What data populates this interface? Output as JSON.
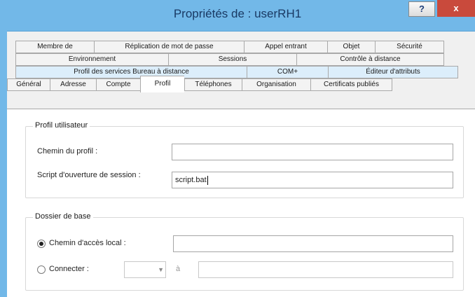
{
  "window": {
    "title": "Propriétés de : userRH1",
    "help_label": "?",
    "close_label": "x"
  },
  "tabs": {
    "row1": [
      "Membre de",
      "Réplication de mot de passe",
      "Appel entrant",
      "Objet",
      "Sécurité"
    ],
    "row2": [
      "Environnement",
      "Sessions",
      "Contrôle à distance"
    ],
    "row3": [
      "Profil des services Bureau à distance",
      "COM+",
      "Éditeur d'attributs"
    ],
    "row4": [
      "Général",
      "Adresse",
      "Compte",
      "Profil",
      "Téléphones",
      "Organisation",
      "Certificats publiés"
    ],
    "active": "Profil"
  },
  "profil_utilisateur": {
    "legend": "Profil utilisateur",
    "chemin_label": "Chemin du profil :",
    "chemin_value": "",
    "script_label": "Script d'ouverture de session :",
    "script_value": "script.bat"
  },
  "dossier_de_base": {
    "legend": "Dossier de base",
    "local_label": "Chemin d'accès local :",
    "local_value": "",
    "local_selected": true,
    "connect_label": "Connecter :",
    "connect_drive": "",
    "connect_to_label": "à",
    "connect_value": ""
  }
}
